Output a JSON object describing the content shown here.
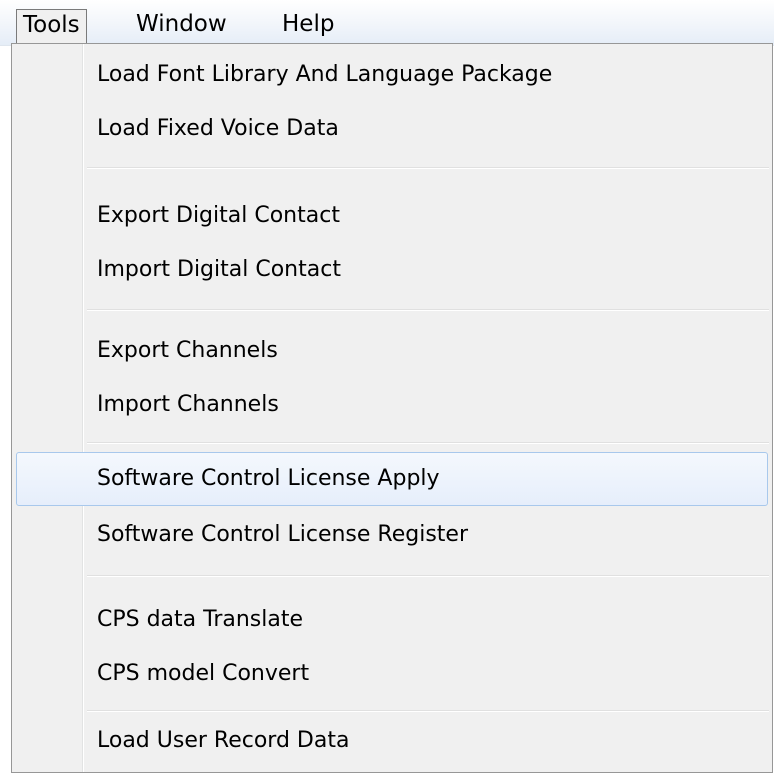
{
  "menubar": {
    "items": [
      {
        "label": "Tools"
      },
      {
        "label": "Window"
      },
      {
        "label": "Help"
      }
    ]
  },
  "menu": {
    "items": [
      {
        "label": "Load Font Library And Language Package"
      },
      {
        "label": "Load Fixed Voice Data"
      },
      {
        "label": "Export Digital Contact"
      },
      {
        "label": "Import Digital Contact"
      },
      {
        "label": "Export Channels"
      },
      {
        "label": "Import Channels"
      },
      {
        "label": "Software Control License Apply"
      },
      {
        "label": "Software Control License Register"
      },
      {
        "label": "CPS data Translate"
      },
      {
        "label": "CPS model Convert"
      },
      {
        "label": "Load User Record Data"
      }
    ]
  },
  "colors": {
    "highlight_border": "#a8c8ec",
    "menu_background": "#f0f0f0",
    "menu_border": "#979797"
  }
}
